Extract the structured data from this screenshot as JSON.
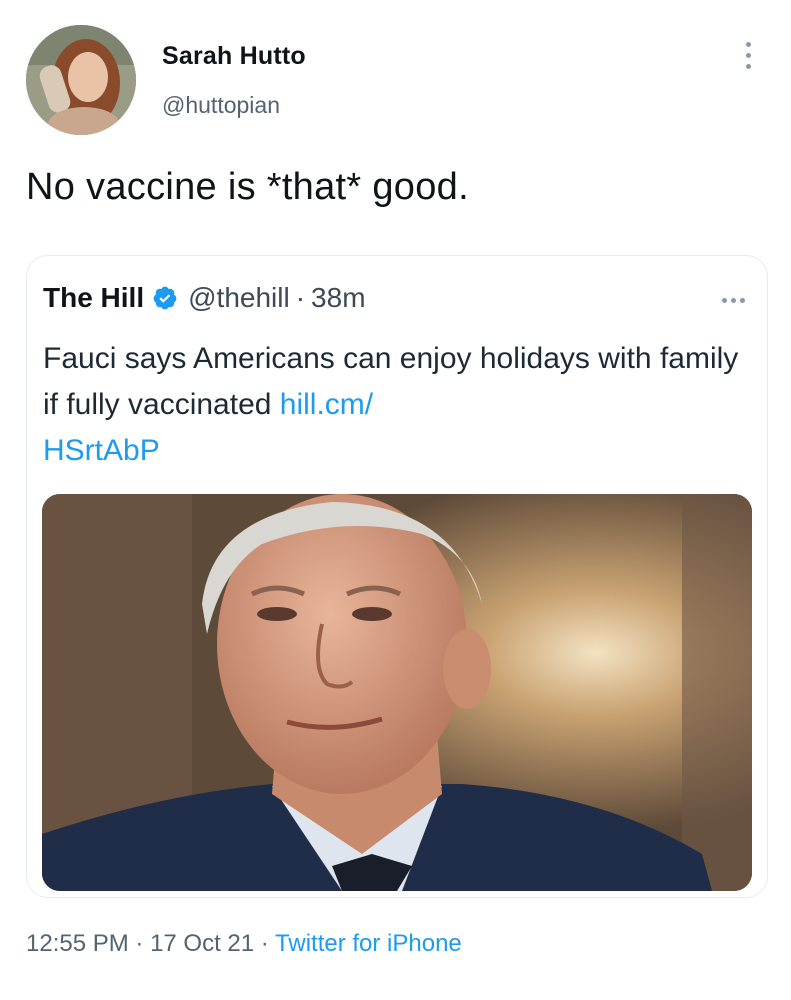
{
  "author": {
    "name": "Sarah Hutto",
    "handle": "@huttopian"
  },
  "tweet": {
    "text": "No vaccine is *that* good."
  },
  "quoted": {
    "name": "The Hill",
    "verified_icon": "verified-badge-icon",
    "handle": "@thehill",
    "separator": "·",
    "time": "38m",
    "text": "Fauci says Americans can enjoy holidays with family if fully vaccinated ",
    "link": "hill.cm/HSrtAbP",
    "link_line1": "hill.cm/",
    "link_line2": "HSrtAbP"
  },
  "meta": {
    "time": "12:55 PM",
    "sep1": " · ",
    "date": "17 Oct 21",
    "sep2": " · ",
    "source": "Twitter for iPhone"
  },
  "colors": {
    "accent": "#1d9bf0",
    "secondary_text": "#536471",
    "primary_text": "#0f1419"
  }
}
